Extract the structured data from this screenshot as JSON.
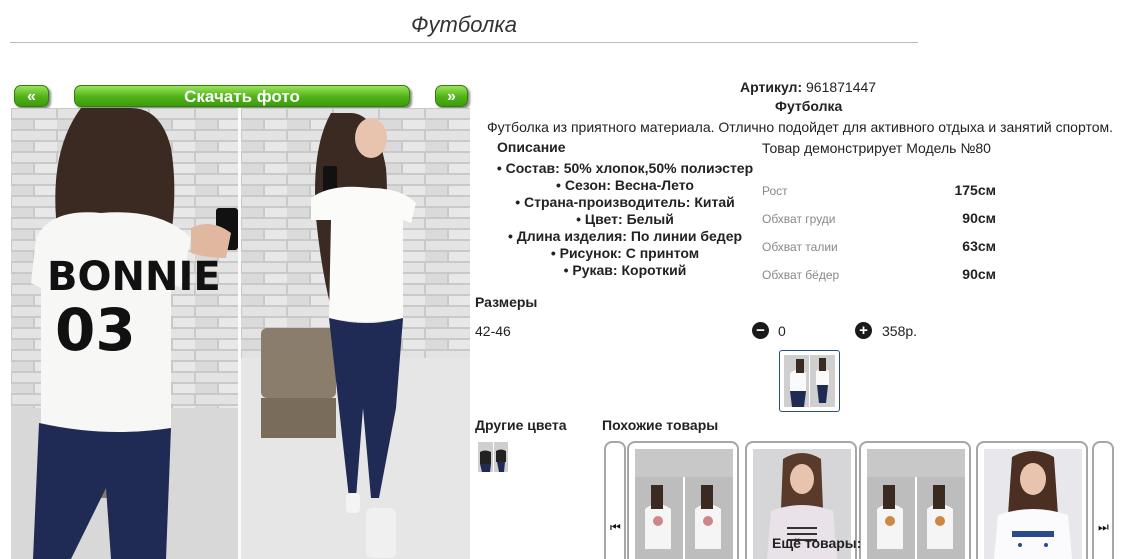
{
  "page": {
    "title": "Футболка"
  },
  "nav": {
    "prev_label": "«",
    "download_label": "Скачать фото",
    "next_label": "»"
  },
  "photo": {
    "text_line1": "BONNIE",
    "text_line2": "03"
  },
  "product": {
    "artikul_label": "Артикул:",
    "artikul_value": "961871447",
    "name": "Футболка",
    "description": "Футболка из приятного материала. Отлично подойдет для активного отдыха и занятий спортом.",
    "description_heading": "Описание",
    "model_line": "Товар демонстрирует Модель №80",
    "specs": [
      "Состав: 50% хлопок,50% полиэстер",
      "Сезон: Весна-Лето",
      "Страна-производитель: Китай",
      "Цвет: Белый",
      "Длина изделия: По линии бедер",
      "Рисунок: С принтом",
      "Рукав: Короткий"
    ],
    "measurements": [
      {
        "label": "Рост",
        "value": "175см"
      },
      {
        "label": "Обхват груди",
        "value": "90см"
      },
      {
        "label": "Обхват талии",
        "value": "63см"
      },
      {
        "label": "Обхват бёдер",
        "value": "90см"
      }
    ]
  },
  "order": {
    "sizes_heading": "Размеры",
    "size_value": "42-46",
    "minus_icon": "−",
    "plus_icon": "+",
    "quantity": "0",
    "price": "358р."
  },
  "related": {
    "other_colors_heading": "Другие цвета",
    "similar_heading": "Похожие товары",
    "more_items_label": "Ещё товары:"
  },
  "colors": {
    "accent_green": "#4fb217",
    "thumb_border": "#2b4c8c",
    "jeans": "#1f2a55"
  }
}
